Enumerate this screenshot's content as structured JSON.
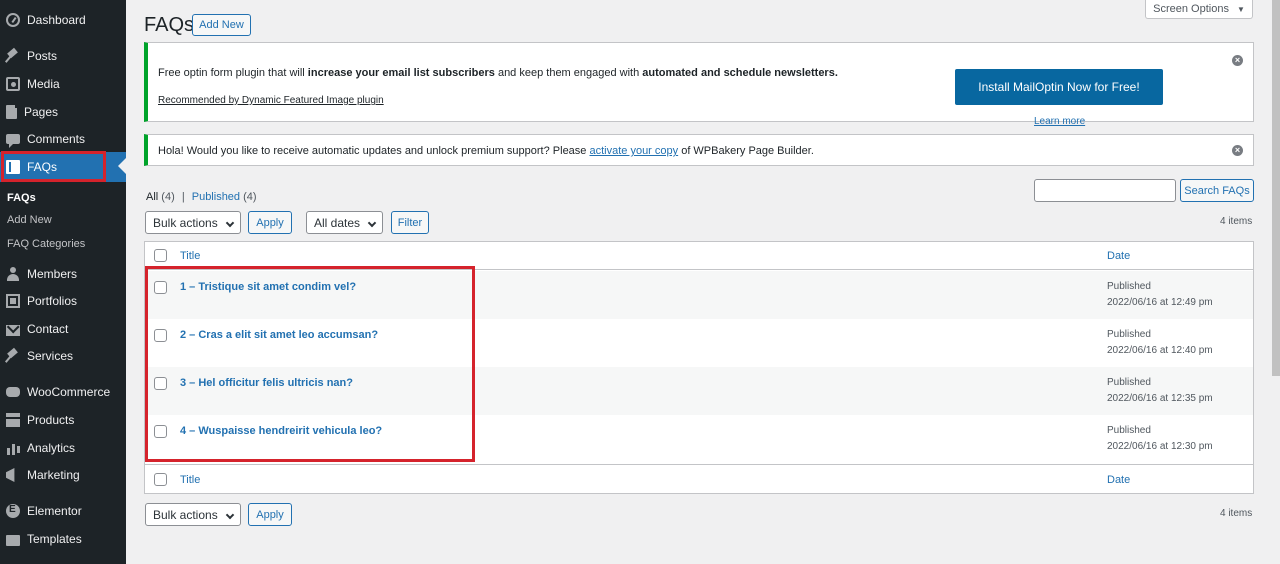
{
  "sidebar": {
    "items": [
      {
        "label": "Dashboard",
        "icon": "gauge-icon"
      },
      {
        "label": "Posts",
        "icon": "pin-icon"
      },
      {
        "label": "Media",
        "icon": "media-icon"
      },
      {
        "label": "Pages",
        "icon": "page-icon"
      },
      {
        "label": "Comments",
        "icon": "comment-icon"
      },
      {
        "label": "FAQs",
        "icon": "book-icon"
      },
      {
        "label": "Members",
        "icon": "user-icon"
      },
      {
        "label": "Portfolios",
        "icon": "portfolio-icon"
      },
      {
        "label": "Contact",
        "icon": "mail-icon"
      },
      {
        "label": "Services",
        "icon": "pin-icon"
      },
      {
        "label": "WooCommerce",
        "icon": "woocommerce-icon"
      },
      {
        "label": "Products",
        "icon": "box-icon"
      },
      {
        "label": "Analytics",
        "icon": "bar-chart-icon"
      },
      {
        "label": "Marketing",
        "icon": "megaphone-icon"
      },
      {
        "label": "Elementor",
        "icon": "elementor-icon"
      },
      {
        "label": "Templates",
        "icon": "folder-icon"
      }
    ],
    "submenu": [
      "FAQs",
      "Add New",
      "FAQ Categories"
    ],
    "active_color": "#2271b1"
  },
  "header": {
    "title": "FAQs",
    "add_new": "Add New",
    "screen_options": "Screen Options"
  },
  "notice1": {
    "text_a": "Free optin form plugin that will ",
    "text_b": "increase your email list subscribers",
    "text_c": " and keep them engaged with ",
    "text_d": "automated and schedule newsletters.",
    "recommended": "Recommended by Dynamic Featured Image plugin",
    "button": "Install MailOptin Now for Free!",
    "learn_more": "Learn more"
  },
  "notice2": {
    "text_a": "Hola! Would you like to receive automatic updates and unlock premium support? Please ",
    "link": "activate your copy",
    "text_b": " of WPBakery Page Builder."
  },
  "filters": {
    "all": "All",
    "all_count": "(4)",
    "separator": "|",
    "published": "Published",
    "published_count": "(4)",
    "bulk_actions": "Bulk actions",
    "apply": "Apply",
    "all_dates": "All dates",
    "filter": "Filter",
    "search_button": "Search FAQs",
    "items_count": "4 items"
  },
  "table": {
    "col_title": "Title",
    "col_date": "Date",
    "rows": [
      {
        "title": "1 – Tristique sit amet condim vel?",
        "status": "Published",
        "date": "2022/06/16 at 12:49 pm"
      },
      {
        "title": "2 – Cras a elit sit amet leo accumsan?",
        "status": "Published",
        "date": "2022/06/16 at 12:40 pm"
      },
      {
        "title": "3 – Hel officitur felis ultricis nan?",
        "status": "Published",
        "date": "2022/06/16 at 12:35 pm"
      },
      {
        "title": "4 – Wuspaisse hendreirit vehicula leo?",
        "status": "Published",
        "date": "2022/06/16 at 12:30 pm"
      }
    ]
  },
  "highlight_color": "#d5232c"
}
